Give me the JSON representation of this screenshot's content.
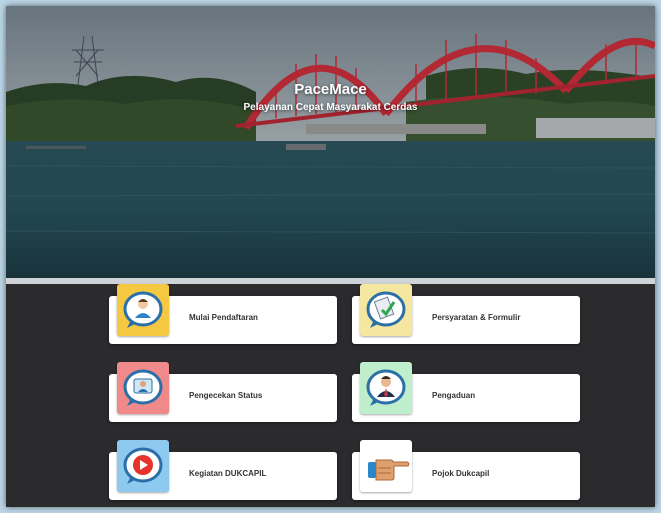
{
  "app": {
    "title": "PaceMace",
    "subtitle": "Pelayanan Cepat Masyarakat Cerdas"
  },
  "menu": [
    {
      "label": "Mulai Pendaftaran",
      "icon": "user-chat-icon",
      "tile_color": "#f5c842"
    },
    {
      "label": "Persyaratan & Formulir",
      "icon": "document-check-icon",
      "tile_color": "#f5e7a0"
    },
    {
      "label": "Pengecekan Status",
      "icon": "status-chat-icon",
      "tile_color": "#f08a8a"
    },
    {
      "label": "Pengaduan",
      "icon": "officer-chat-icon",
      "tile_color": "#bfeecd"
    },
    {
      "label": "Kegiatan DUKCAPIL",
      "icon": "play-video-icon",
      "tile_color": "#8ecaf0"
    },
    {
      "label": "Pojok Dukcapil",
      "icon": "pointing-hand-icon",
      "tile_color": "#ffffff"
    }
  ]
}
